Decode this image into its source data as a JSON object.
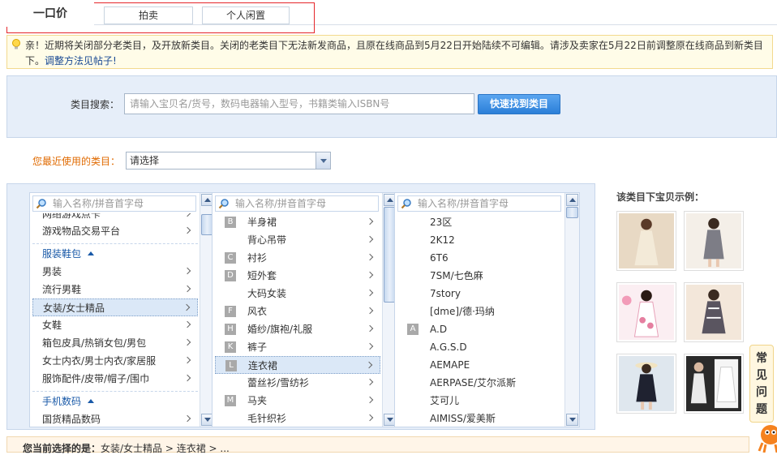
{
  "tabs": [
    {
      "label": "一口价"
    },
    {
      "label": "拍卖"
    },
    {
      "label": "个人闲置"
    }
  ],
  "notice": {
    "text": "亲！近期将关闭部分老类目，及开放新类目。关闭的老类目下无法新发商品，且原在线商品到5月22日开始陆续不可编辑。请涉及卖家在5月22日前调整原在线商品到新类目下。",
    "link": "调整方法见帖子!"
  },
  "search": {
    "label": "类目搜索：",
    "placeholder": "请输入宝贝名/货号，数码电器输入型号，书籍类输入ISBN号",
    "button": "快速找到类目"
  },
  "recent": {
    "label": "您最近使用的类目：",
    "value": "请选择"
  },
  "columns": {
    "search_placeholder": "输入名称/拼音首字母",
    "col1": {
      "top_partial": "网络游戏点卡",
      "items_before": [
        "游戏物品交易平台"
      ],
      "group1": "服装鞋包",
      "group1_items": [
        "男装",
        "流行男鞋",
        "女装/女士精品",
        "女鞋",
        "箱包皮具/热销女包/男包",
        "女士内衣/男士内衣/家居服",
        "服饰配件/皮带/帽子/围巾"
      ],
      "group2": "手机数码",
      "group2_items": [
        "国货精品数码"
      ]
    },
    "col2": {
      "items": [
        {
          "letter": "B",
          "label": "半身裙"
        },
        {
          "letter": "",
          "label": "背心吊带"
        },
        {
          "letter": "C",
          "label": "衬衫"
        },
        {
          "letter": "D",
          "label": "短外套"
        },
        {
          "letter": "",
          "label": "大码女装"
        },
        {
          "letter": "F",
          "label": "风衣"
        },
        {
          "letter": "H",
          "label": "婚纱/旗袍/礼服"
        },
        {
          "letter": "K",
          "label": "裤子"
        },
        {
          "letter": "L",
          "label": "连衣裙"
        },
        {
          "letter": "",
          "label": "蕾丝衫/雪纺衫"
        },
        {
          "letter": "M",
          "label": "马夹"
        },
        {
          "letter": "",
          "label": "毛针织衫"
        }
      ]
    },
    "col3": {
      "items": [
        {
          "letter": "",
          "label": "23区"
        },
        {
          "letter": "",
          "label": "2K12"
        },
        {
          "letter": "",
          "label": "6T6"
        },
        {
          "letter": "",
          "label": "7SM/七色麻"
        },
        {
          "letter": "",
          "label": "7story"
        },
        {
          "letter": "",
          "label": "[dme]/德·玛纳"
        },
        {
          "letter": "A",
          "label": "A.D"
        },
        {
          "letter": "",
          "label": "A.G.S.D"
        },
        {
          "letter": "",
          "label": "AEMAPE"
        },
        {
          "letter": "",
          "label": "AERPASE/艾尔派斯"
        },
        {
          "letter": "",
          "label": "艾可儿"
        },
        {
          "letter": "",
          "label": "AIMISS/爱美斯"
        }
      ]
    }
  },
  "examples": {
    "title": "该类目下宝贝示例："
  },
  "faq": {
    "label": [
      "常",
      "见",
      "问",
      "题"
    ]
  },
  "bottom": {
    "label": "您当前选择的是：",
    "path": "女装/女士精品 > 连衣裙 > ..."
  }
}
